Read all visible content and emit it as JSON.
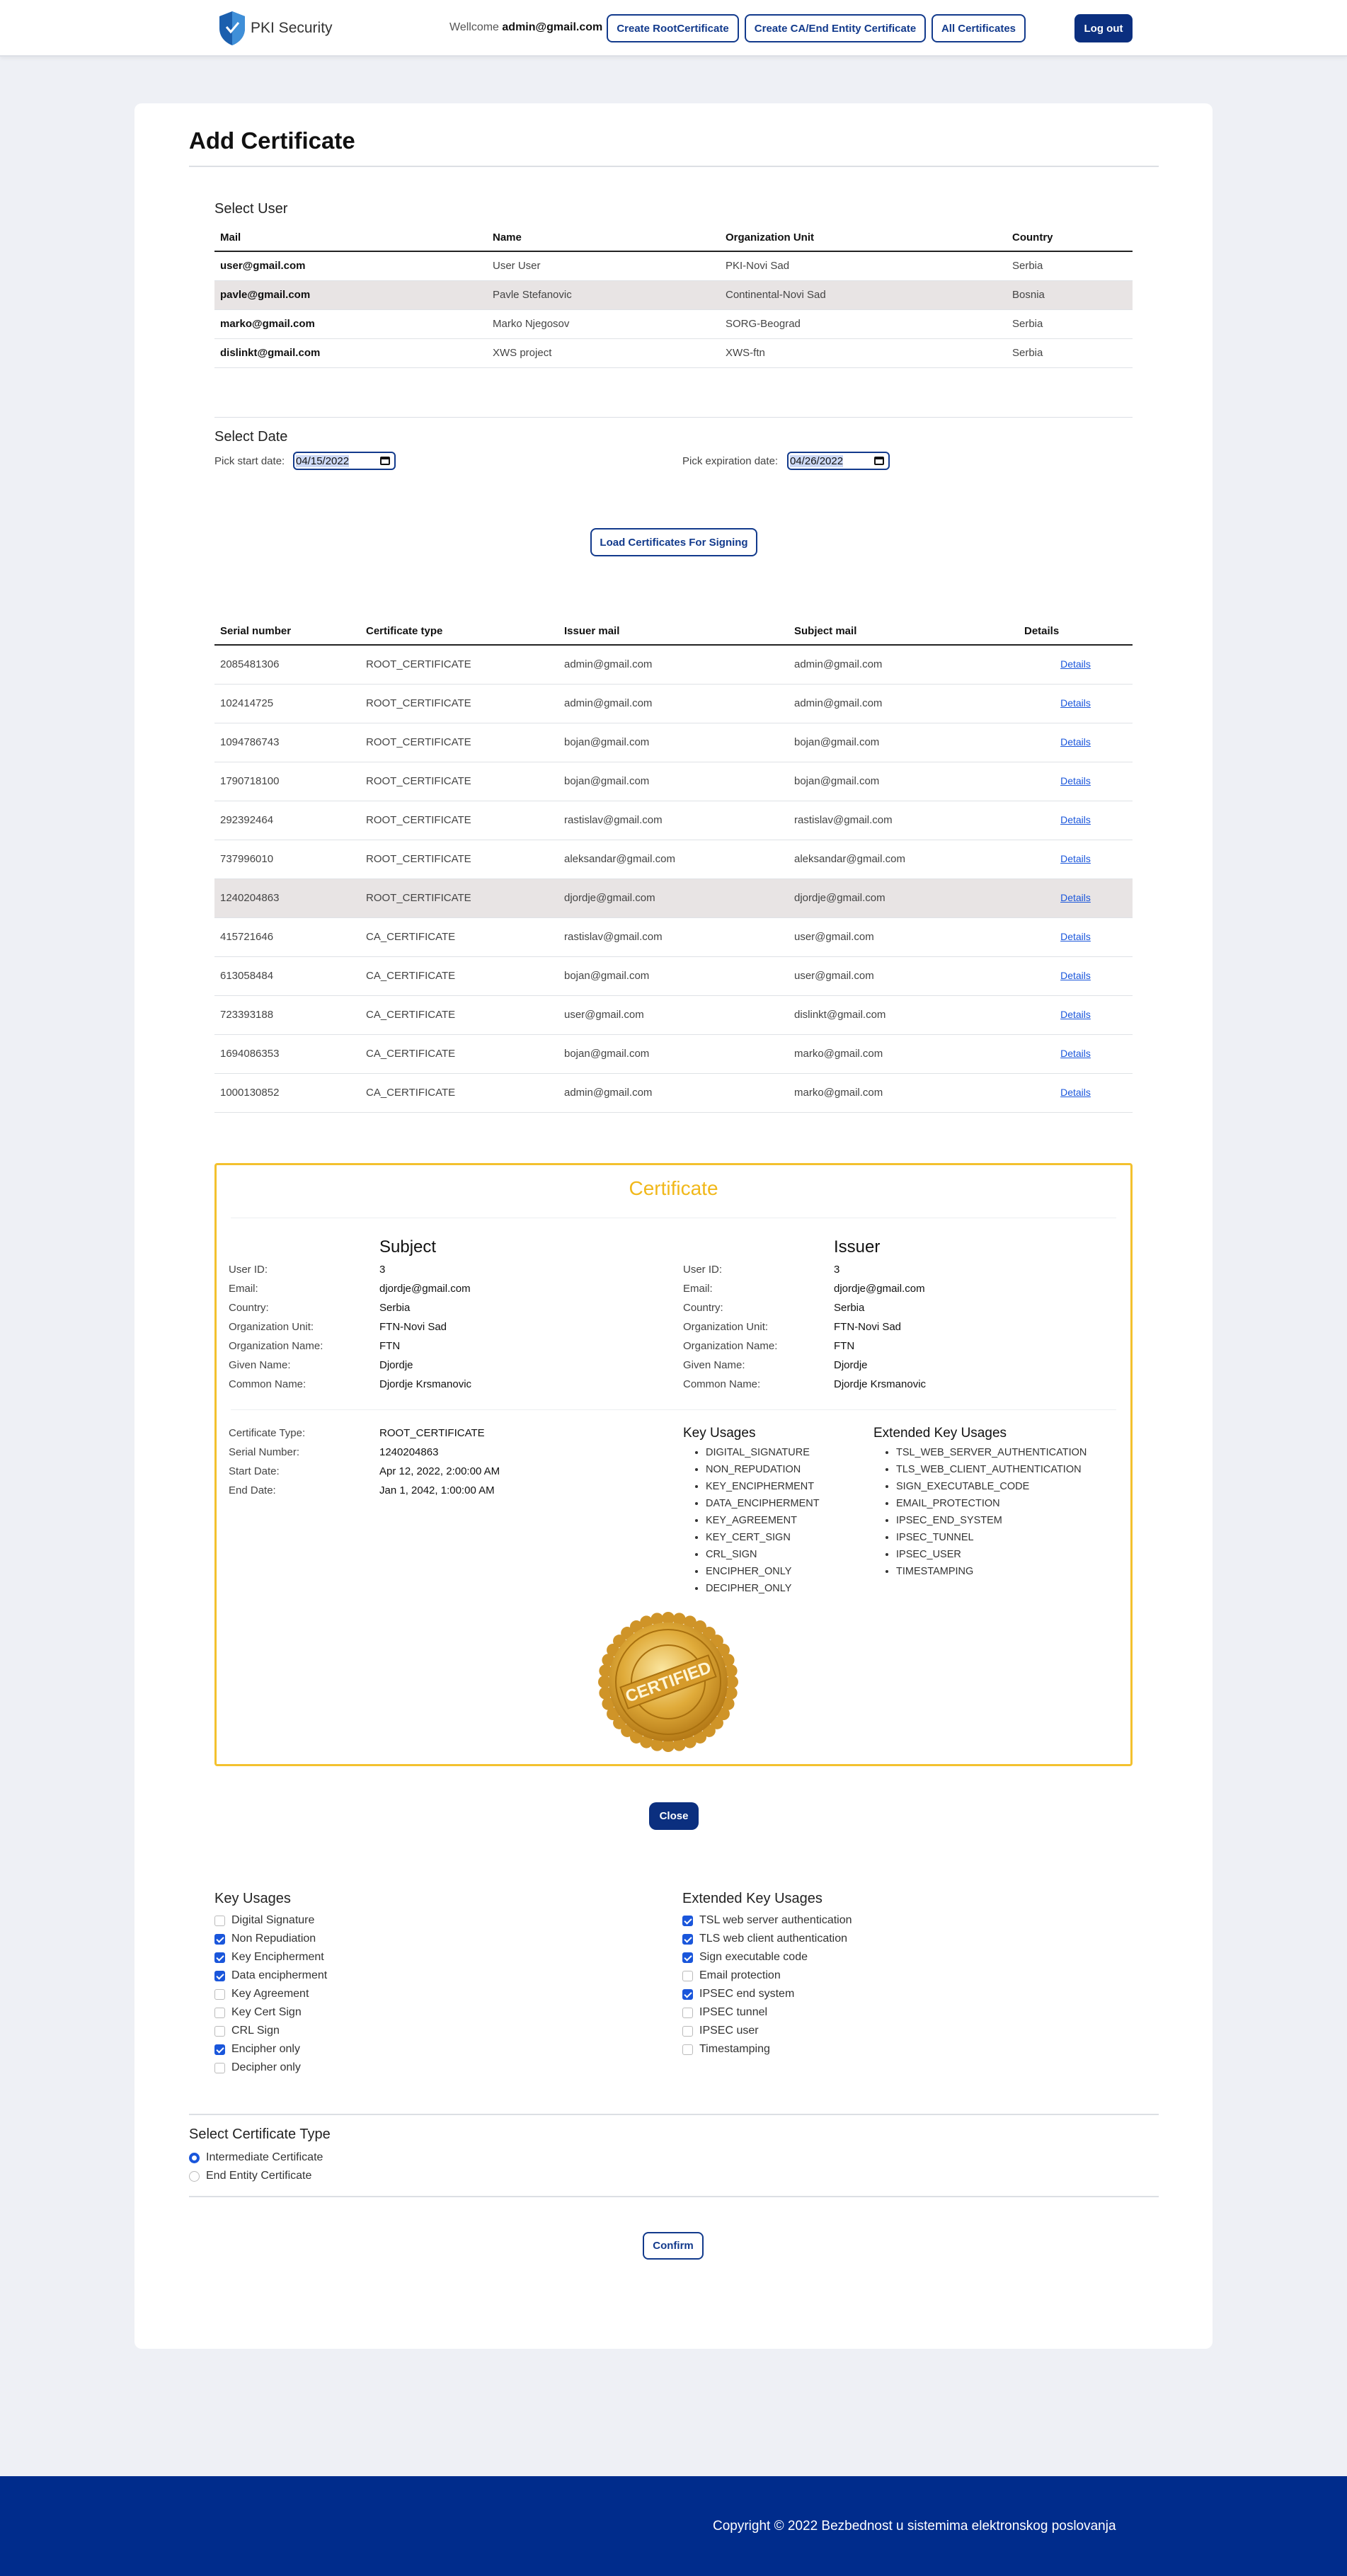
{
  "navbar": {
    "brand": "PKI Security",
    "welcome_prefix": "Wellcome",
    "welcome_user": "admin@gmail.com",
    "buttons": {
      "create_root": "Create RootCertificate",
      "create_ca": "Create CA/End Entity Certificate",
      "all_certs": "All Certificates",
      "logout": "Log out"
    }
  },
  "page": {
    "title": "Add Certificate"
  },
  "users": {
    "title": "Select User",
    "headers": [
      "Mail",
      "Name",
      "Organization Unit",
      "Country"
    ],
    "rows": [
      [
        "user@gmail.com",
        "User User",
        "PKI-Novi Sad",
        "Serbia"
      ],
      [
        "pavle@gmail.com",
        "Pavle Stefanovic",
        "Continental-Novi Sad",
        "Bosnia"
      ],
      [
        "marko@gmail.com",
        "Marko Njegosov",
        "SORG-Beograd",
        "Serbia"
      ],
      [
        "dislinkt@gmail.com",
        "XWS project",
        "XWS-ftn",
        "Serbia"
      ]
    ],
    "selected_index": 1
  },
  "dates": {
    "title": "Select Date",
    "start_label": "Pick start date:",
    "start_value": "04/15/2022",
    "end_label": "Pick expiration date:",
    "end_value": "04/26/2022"
  },
  "load_button": "Load Certificates For Signing",
  "certificates": {
    "headers": [
      "Serial number",
      "Certificate type",
      "Issuer mail",
      "Subject mail",
      "Details"
    ],
    "link_label": "Details",
    "rows": [
      [
        "2085481306",
        "ROOT_CERTIFICATE",
        "admin@gmail.com",
        "admin@gmail.com"
      ],
      [
        "102414725",
        "ROOT_CERTIFICATE",
        "admin@gmail.com",
        "admin@gmail.com"
      ],
      [
        "1094786743",
        "ROOT_CERTIFICATE",
        "bojan@gmail.com",
        "bojan@gmail.com"
      ],
      [
        "1790718100",
        "ROOT_CERTIFICATE",
        "bojan@gmail.com",
        "bojan@gmail.com"
      ],
      [
        "292392464",
        "ROOT_CERTIFICATE",
        "rastislav@gmail.com",
        "rastislav@gmail.com"
      ],
      [
        "737996010",
        "ROOT_CERTIFICATE",
        "aleksandar@gmail.com",
        "aleksandar@gmail.com"
      ],
      [
        "1240204863",
        "ROOT_CERTIFICATE",
        "djordje@gmail.com",
        "djordje@gmail.com"
      ],
      [
        "415721646",
        "CA_CERTIFICATE",
        "rastislav@gmail.com",
        "user@gmail.com"
      ],
      [
        "613058484",
        "CA_CERTIFICATE",
        "bojan@gmail.com",
        "user@gmail.com"
      ],
      [
        "723393188",
        "CA_CERTIFICATE",
        "user@gmail.com",
        "dislinkt@gmail.com"
      ],
      [
        "1694086353",
        "CA_CERTIFICATE",
        "bojan@gmail.com",
        "marko@gmail.com"
      ],
      [
        "1000130852",
        "CA_CERTIFICATE",
        "admin@gmail.com",
        "marko@gmail.com"
      ]
    ],
    "selected_index": 6
  },
  "cert_detail": {
    "heading": "Certificate",
    "field_labels": [
      "User ID:",
      "Email:",
      "Country:",
      "Organization Unit:",
      "Organization Name:",
      "Given Name:",
      "Common Name:"
    ],
    "subject": {
      "title": "Subject",
      "values": [
        "3",
        "djordje@gmail.com",
        "Serbia",
        "FTN-Novi Sad",
        "FTN",
        "Djordje",
        "Djordje Krsmanovic"
      ]
    },
    "issuer": {
      "title": "Issuer",
      "values": [
        "3",
        "djordje@gmail.com",
        "Serbia",
        "FTN-Novi Sad",
        "FTN",
        "Djordje",
        "Djordje Krsmanovic"
      ]
    },
    "info_labels": [
      "Certificate Type:",
      "Serial Number:",
      "Start Date:",
      "End Date:"
    ],
    "info_values": [
      "ROOT_CERTIFICATE",
      "1240204863",
      "Apr 12, 2022, 2:00:00 AM",
      "Jan 1, 2042, 1:00:00 AM"
    ],
    "key_usages_title": "Key Usages",
    "key_usages": [
      "DIGITAL_SIGNATURE",
      "NON_REPUDATION",
      "KEY_ENCIPHERMENT",
      "DATA_ENCIPHERMENT",
      "KEY_AGREEMENT",
      "KEY_CERT_SIGN",
      "CRL_SIGN",
      "ENCIPHER_ONLY",
      "DECIPHER_ONLY"
    ],
    "ext_key_usages_title": "Extended Key Usages",
    "ext_key_usages": [
      "TSL_WEB_SERVER_AUTHENTICATION",
      "TLS_WEB_CLIENT_AUTHENTICATION",
      "SIGN_EXECUTABLE_CODE",
      "EMAIL_PROTECTION",
      "IPSEC_END_SYSTEM",
      "IPSEC_TUNNEL",
      "IPSEC_USER",
      "TIMESTAMPING"
    ],
    "seal_text": "CERTIFIED"
  },
  "close_button": "Close",
  "key_usage_form": {
    "title": "Key Usages",
    "items": [
      {
        "label": "Digital Signature",
        "checked": false
      },
      {
        "label": "Non Repudiation",
        "checked": true
      },
      {
        "label": "Key Encipherment",
        "checked": true
      },
      {
        "label": "Data encipherment",
        "checked": true
      },
      {
        "label": "Key Agreement",
        "checked": false
      },
      {
        "label": "Key Cert Sign",
        "checked": false
      },
      {
        "label": "CRL Sign",
        "checked": false
      },
      {
        "label": "Encipher only",
        "checked": true
      },
      {
        "label": "Decipher only",
        "checked": false
      }
    ]
  },
  "ext_key_usage_form": {
    "title": "Extended Key Usages",
    "items": [
      {
        "label": "TSL web server authentication",
        "checked": true
      },
      {
        "label": "TLS web client authentication",
        "checked": true
      },
      {
        "label": "Sign executable code",
        "checked": true
      },
      {
        "label": "Email protection",
        "checked": false
      },
      {
        "label": "IPSEC end system",
        "checked": true
      },
      {
        "label": "IPSEC tunnel",
        "checked": false
      },
      {
        "label": "IPSEC user",
        "checked": false
      },
      {
        "label": "Timestamping",
        "checked": false
      }
    ]
  },
  "cert_type": {
    "title": "Select Certificate Type",
    "options": [
      {
        "label": "Intermediate Certificate",
        "selected": true
      },
      {
        "label": "End Entity Certificate",
        "selected": false
      }
    ]
  },
  "confirm_button": "Confirm",
  "footer": {
    "text": "Copyright © 2022 Bezbednost u sistemima elektronskog poslovanja"
  },
  "colors": {
    "primary": "#0b2f7f",
    "accent_gold": "#f3c12e",
    "footer": "#002c8c",
    "selected_row": "#e8e4e4"
  }
}
